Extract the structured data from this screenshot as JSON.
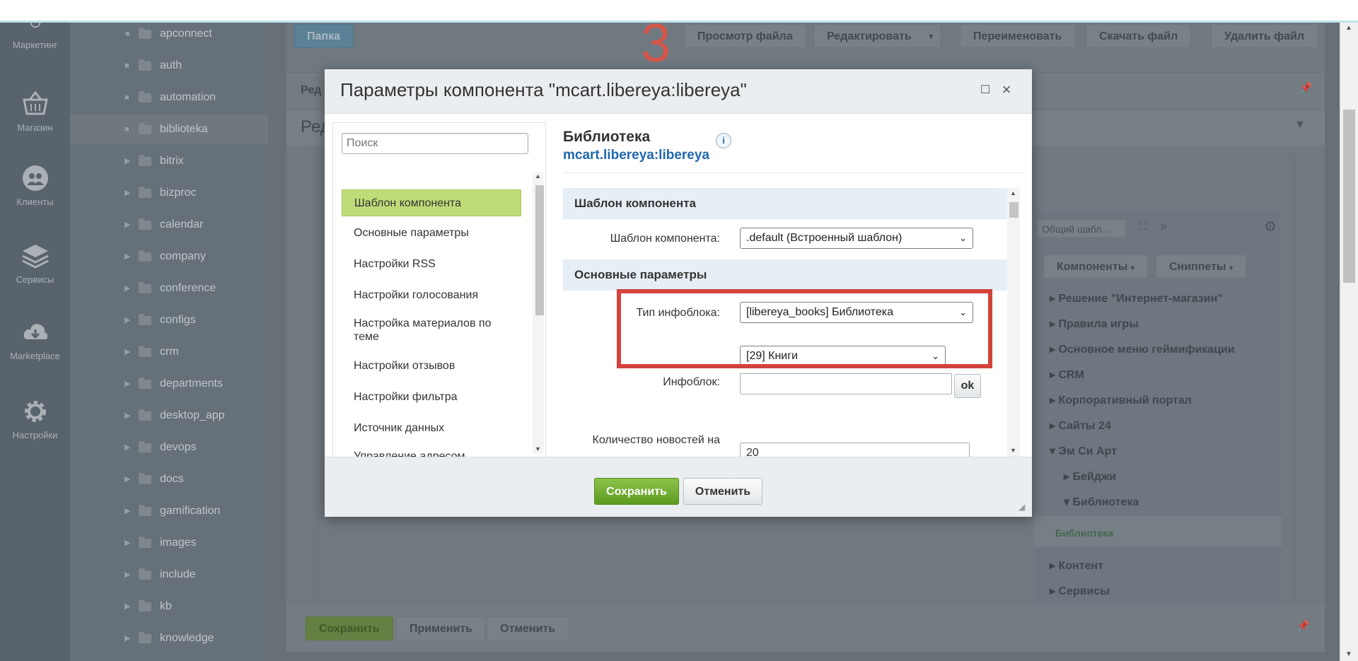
{
  "annotation_number": "3",
  "left_nav": [
    {
      "label": "Маркетинг",
      "icon": "target-icon"
    },
    {
      "label": "Магазин",
      "icon": "basket-icon"
    },
    {
      "label": "Клиенты",
      "icon": "clients-icon"
    },
    {
      "label": "Сервисы",
      "icon": "layers-icon"
    },
    {
      "label": "Marketplace",
      "icon": "cloud-download-icon"
    },
    {
      "label": "Настройки",
      "icon": "gear-icon"
    }
  ],
  "file_tree": [
    {
      "label": "apconnect"
    },
    {
      "label": "auth"
    },
    {
      "label": "automation"
    },
    {
      "label": "biblioteka"
    },
    {
      "label": "bitrix"
    },
    {
      "label": "bizproc"
    },
    {
      "label": "calendar"
    },
    {
      "label": "company"
    },
    {
      "label": "conference"
    },
    {
      "label": "configs"
    },
    {
      "label": "crm"
    },
    {
      "label": "departments"
    },
    {
      "label": "desktop_app"
    },
    {
      "label": "devops"
    },
    {
      "label": "docs"
    },
    {
      "label": "gamification"
    },
    {
      "label": "images"
    },
    {
      "label": "include"
    },
    {
      "label": "kb"
    },
    {
      "label": "knowledge"
    }
  ],
  "toolbar": {
    "folder": "Папка",
    "view_file": "Просмотр файла",
    "edit": "Редактировать",
    "rename": "Переименовать",
    "download": "Скачать файл",
    "delete": "Удалить файл"
  },
  "bg_labels": {
    "red_a": "Ред",
    "red_b": "Ред",
    "template_select": "Общий шабл..."
  },
  "components_panel": {
    "tab_components": "Компоненты",
    "tab_snippets": "Сниппеты",
    "items": [
      "Решение \"Интернет-магазин\"",
      "Правила игры",
      "Основное меню геймификации",
      "CRM",
      "Корпоративный портал",
      "Сайты 24",
      "Эм Си Арт",
      "Бейджи",
      "Библиотека",
      "Библиотека",
      "Контент",
      "Сервисы"
    ]
  },
  "bottom_bar": {
    "save": "Сохранить",
    "apply": "Применить",
    "cancel": "Отменить"
  },
  "dialog": {
    "title": "Параметры компонента \"mcart.libereya:libereya\"",
    "search_placeholder": "Поиск",
    "sections": [
      "Шаблон компонента",
      "Основные параметры",
      "Настройки RSS",
      "Настройки голосования",
      "Настройка материалов по теме",
      "Настройки отзывов",
      "Настройки фильтра",
      "Источник данных",
      "Управление адресом"
    ],
    "component_title": "Библиотека",
    "component_code": "mcart.libereya:libereya",
    "info": "i",
    "groups": {
      "template": "Шаблон компонента",
      "main": "Основные параметры"
    },
    "fields": {
      "template_label": "Шаблон компонента:",
      "template_value": ".default (Встроенный шаблон)",
      "iblock_type_label": "Тип инфоблока:",
      "iblock_type_value": "[libereya_books] Библиотека",
      "iblock_select_value": "[29] Книги",
      "iblock_label": "Инфоблок:",
      "iblock_input": "",
      "ok": "ok",
      "news_count_label": "Количество новостей на",
      "news_count_value": "20"
    },
    "save": "Сохранить",
    "cancel": "Отменить"
  }
}
